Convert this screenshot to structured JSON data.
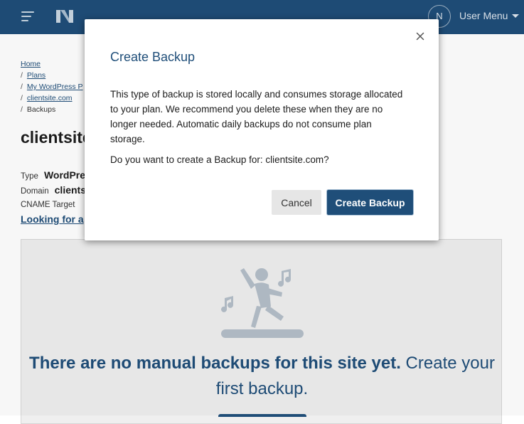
{
  "header": {
    "avatar_initial": "N",
    "user_menu_label": "User Menu"
  },
  "breadcrumb": {
    "items": [
      {
        "label": "Home",
        "link": true
      },
      {
        "label": "Plans",
        "link": true
      },
      {
        "label": "My WordPress P",
        "link": true
      },
      {
        "label": "clientsite.com",
        "link": true
      },
      {
        "label": "Backups",
        "link": false
      }
    ]
  },
  "site": {
    "title": "clientsite",
    "type_label": "Type",
    "type_value": "WordPre",
    "domain_label": "Domain",
    "domain_value": "clients",
    "cname_label": "CNAME Target",
    "looking_link": "Looking for a"
  },
  "empty_state": {
    "bold_text": "There are no manual backups for this site yet.",
    "normal_text": " Create your first backup."
  },
  "modal": {
    "title": "Create Backup",
    "paragraph1": "This type of backup is stored locally and consumes storage allocated to your plan. We recommend you delete these when they are no longer needed. Automatic daily backups do not consume plan storage.",
    "paragraph2": "Do you want to create a Backup for: clientsite.com?",
    "cancel_label": "Cancel",
    "create_label": "Create Backup"
  },
  "colors": {
    "brand": "#1f4e79",
    "panel_bg": "#efefef",
    "illustration": "#b4bec9"
  },
  "icons": [
    "menu-icon",
    "logo-icon",
    "caret-down-icon",
    "close-icon",
    "dancing-person-icon"
  ]
}
